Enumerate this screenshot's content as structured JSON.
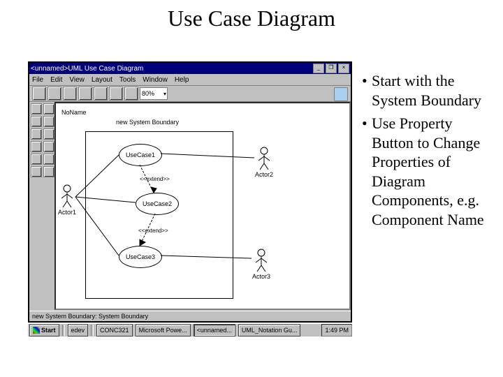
{
  "title": "Use Case Diagram",
  "window": {
    "title": "<unnamed>UML Use Case Diagram",
    "menus": [
      "File",
      "Edit",
      "View",
      "Layout",
      "Tools",
      "Window",
      "Help"
    ],
    "zoom": "80%",
    "noname": "NoName",
    "boundary_label": "new System Boundary",
    "usecases": [
      "UseCase1",
      "UseCase2",
      "UseCase3"
    ],
    "actors": [
      "Actor1",
      "Actor2",
      "Actor3"
    ],
    "ext_labels": [
      "<<extend>>",
      "<<extend>>"
    ],
    "status": "new System Boundary: System Boundary"
  },
  "taskbar": {
    "start": "Start",
    "quick": "edev",
    "tasks": [
      "CONC321",
      "Microsoft Powe...",
      "<unnamed...",
      "UML_Notation Gu..."
    ],
    "time": "1:49 PM"
  },
  "bullets": [
    "Start with the System Boundary",
    "Use Property Button to Change Properties of Diagram Components, e.g. Component Name"
  ]
}
